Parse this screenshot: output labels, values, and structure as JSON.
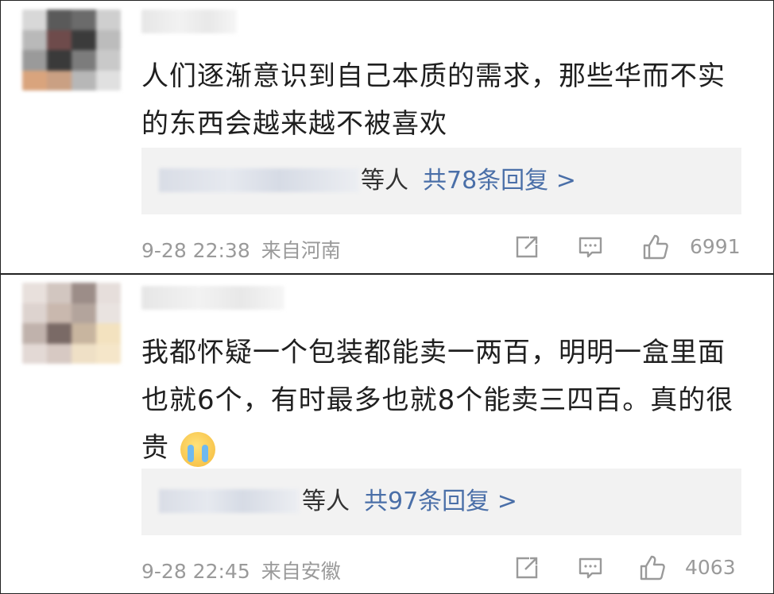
{
  "comments": [
    {
      "text": "人们逐渐意识到自己本质的需求，那些华而不实的东西会越来越不被喜欢",
      "has_emoji": false,
      "reply_suffix": "等人",
      "reply_count_label": "共78条回复 >",
      "time": "9-28 22:38",
      "location": "来自河南",
      "likes": "6991"
    },
    {
      "text": "我都怀疑一个包装都能卖一两百，明明一盒里面也就6个，有时最多也就8个能卖三四百。真的很贵",
      "has_emoji": true,
      "emoji_icon": "crying-face-icon",
      "reply_suffix": "等人",
      "reply_count_label": "共97条回复 >",
      "time": "9-28 22:45",
      "location": "来自安徽",
      "likes": "4063"
    }
  ],
  "icons": [
    "share-icon",
    "comment-icon",
    "like-icon"
  ],
  "colors": {
    "reply_link": "#4a6fa8",
    "meta_gray": "#9a9a9a",
    "reply_bg": "#f2f2f2"
  }
}
